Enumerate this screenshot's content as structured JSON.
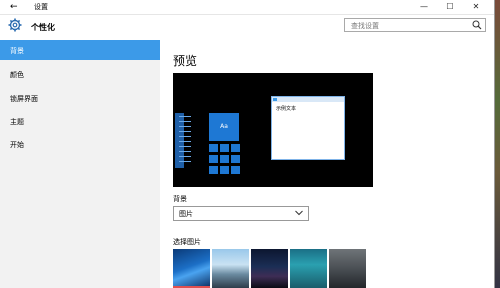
{
  "window": {
    "back_glyph": "←",
    "title": "设置",
    "min_glyph": "—",
    "max_glyph": "☐",
    "close_glyph": "✕"
  },
  "header": {
    "icon": "gear-icon",
    "title": "个性化",
    "search_placeholder": "查找设置",
    "search_icon": "search-icon"
  },
  "sidebar": {
    "items": [
      {
        "label": "背景",
        "active": true
      },
      {
        "label": "颜色",
        "active": false
      },
      {
        "label": "锁屏界面",
        "active": false
      },
      {
        "label": "主题",
        "active": false
      },
      {
        "label": "开始",
        "active": false
      }
    ]
  },
  "main": {
    "preview_title": "预览",
    "preview": {
      "tile_label": "Aa",
      "sample_text": "示例文本"
    },
    "background_label": "背景",
    "background_select_value": "图片",
    "choose_picture_label": "选择图片",
    "thumbnails": [
      "windows-hero",
      "lake-mountain",
      "night-sky",
      "underwater-swimmer",
      "rock-cliff"
    ]
  },
  "colors": {
    "accent": "#3c9ae8",
    "sidebar_bg": "#f2f2f2",
    "tile_blue": "#1e78d4"
  }
}
